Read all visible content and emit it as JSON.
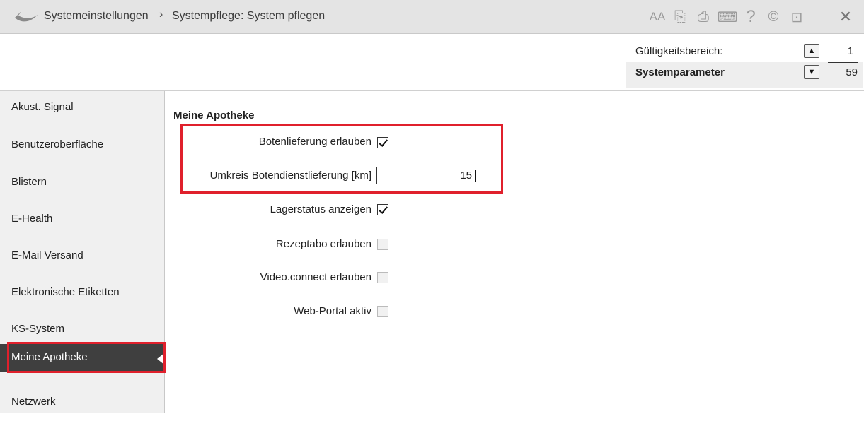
{
  "titlebar": {
    "breadcrumb": [
      "Systemeinstellungen",
      "Systempflege: System pflegen"
    ],
    "separator": "›",
    "icons": [
      "font-size-icon",
      "copy-document-icon",
      "print-icon",
      "monitor-icon",
      "help-icon",
      "info-e-icon",
      "window-back-icon",
      "close-icon"
    ],
    "glyphs": {
      "font_size": "AA",
      "copy": "⎘",
      "print": "⎙",
      "monitor": "⌨",
      "help": "?",
      "info": "©",
      "window": "⊡",
      "close": "✕"
    }
  },
  "header": {
    "scope_label": "Gültigkeitsbereich:",
    "scope_value": "1",
    "category_label": "Systemparameter",
    "category_value": "59"
  },
  "sidebar": {
    "items": [
      {
        "label": "Akust. Signal"
      },
      {
        "label": "Benutzeroberfläche"
      },
      {
        "label": "Blistern"
      },
      {
        "label": "E-Health"
      },
      {
        "label": "E-Mail Versand"
      },
      {
        "label": "Elektronische Etiketten"
      },
      {
        "label": "KS-System"
      },
      {
        "label": "Meine Apotheke",
        "active": true
      },
      {
        "label": "Netzwerk"
      }
    ]
  },
  "content": {
    "section_title": "Meine Apotheke",
    "settings": [
      {
        "label": "Botenlieferung erlauben",
        "type": "checkbox",
        "checked": true
      },
      {
        "label": "Umkreis Botendienstlieferung [km]",
        "type": "number",
        "value": "15"
      },
      {
        "label": "Lagerstatus anzeigen",
        "type": "checkbox",
        "checked": true
      },
      {
        "label": "Rezeptabo erlauben",
        "type": "checkbox",
        "checked": false
      },
      {
        "label": "Video.connect erlauben",
        "type": "checkbox",
        "checked": false
      },
      {
        "label": "Web-Portal aktiv",
        "type": "checkbox",
        "checked": false
      }
    ]
  },
  "colors": {
    "highlight": "#e0202c",
    "sidebar_active": "#3f3f3f",
    "titlebar_bg": "#e4e4e4"
  }
}
